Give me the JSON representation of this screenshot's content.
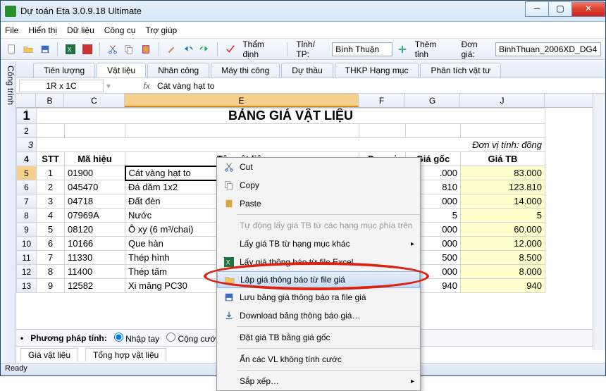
{
  "window": {
    "title": "Dự toán Eta 3.0.9.18 Ultimate"
  },
  "menu": {
    "file": "File",
    "hienthi": "Hiển thị",
    "dulieu": "Dữ liệu",
    "congcu": "Công cụ",
    "trogiup": "Trợ giúp"
  },
  "toolbar": {
    "thamdinh": "Thẩm định",
    "tinhtp": "Tỉnh/ TP:",
    "tinhtp_val": "Bình Thuận",
    "themtinh": "Thêm tỉnh",
    "dongia": "Đơn giá:",
    "dongia_val": "BinhThuan_2006XD_DG48"
  },
  "sidetab": "Công trình",
  "tabs": {
    "tienluong": "Tiên lượng",
    "vatlieu": "Vật liệu",
    "nhancong": "Nhân công",
    "maythicong": "Máy thi công",
    "duthau": "Dự thầu",
    "thkp": "THKP Hạng mục",
    "ptvt": "Phân tích vật tư"
  },
  "formula": {
    "namebox": "1R x 1C",
    "fx": "fx",
    "value": "Cát vàng hạt to"
  },
  "cols": {
    "B": "B",
    "C": "C",
    "E": "E",
    "F": "F",
    "G": "G",
    "J": "J"
  },
  "sheet": {
    "title": "BẢNG GIÁ VẬT LIỆU",
    "unit": "Đơn vị tính: đồng",
    "header": {
      "stt": "STT",
      "mahieu": "Mã hiệu",
      "ten": "Tên vật liệu",
      "donvi": "Đơn vị",
      "giagoc": "Giá gốc",
      "giatb": "Giá TB"
    },
    "rows": [
      {
        "r": "5",
        "stt": "1",
        "mh": "01900",
        "ten": "Cát vàng hạt to",
        "gg": ".000",
        "gtb": "83.000"
      },
      {
        "r": "6",
        "stt": "2",
        "mh": "045470",
        "ten": "Đá dăm 1x2",
        "gg": "810",
        "gtb": "123.810"
      },
      {
        "r": "7",
        "stt": "3",
        "mh": "04718",
        "ten": "Đất đèn",
        "gg": "000",
        "gtb": "14.000"
      },
      {
        "r": "8",
        "stt": "4",
        "mh": "07969A",
        "ten": "Nước",
        "gg": "5",
        "gtb": "5"
      },
      {
        "r": "9",
        "stt": "5",
        "mh": "08120",
        "ten": "Ô xy (6 m³/chai)",
        "gg": "000",
        "gtb": "60.000"
      },
      {
        "r": "10",
        "stt": "6",
        "mh": "10166",
        "ten": "Que hàn",
        "gg": "000",
        "gtb": "12.000"
      },
      {
        "r": "11",
        "stt": "7",
        "mh": "11330",
        "ten": "Thép hình",
        "gg": "500",
        "gtb": "8.500"
      },
      {
        "r": "12",
        "stt": "8",
        "mh": "11400",
        "ten": "Thép tấm",
        "gg": "000",
        "gtb": "8.000"
      },
      {
        "r": "13",
        "stt": "9",
        "mh": "12582",
        "ten": "Xi măng PC30",
        "gg": "940",
        "gtb": "940"
      }
    ]
  },
  "bottom": {
    "pptinh": "Phương pháp tính:",
    "nhaptay": "Nhập tay",
    "congcuoc": "Cộng cước VC",
    "giavl": "Giá vật liệu",
    "tonghop": "Tổng hợp vật liệu"
  },
  "status": "Ready",
  "ctx": {
    "cut": "Cut",
    "copy": "Copy",
    "paste": "Paste",
    "auto": "Tự động lấy giá TB từ các hạng mục phía trên",
    "laytb": "Lấy giá TB từ hạng mục khác",
    "layexcel": "Lấy giá thông báo từ file Excel",
    "lapgia": "Lập giá thông báo từ file giá",
    "luubang": "Lưu bảng giá thông báo ra file giá",
    "download": "Download bảng thông báo giá…",
    "datgia": "Đặt giá TB bằng giá gốc",
    "anvl": "Ẩn các VL không tính cước",
    "sapxep": "Sắp xếp…"
  }
}
